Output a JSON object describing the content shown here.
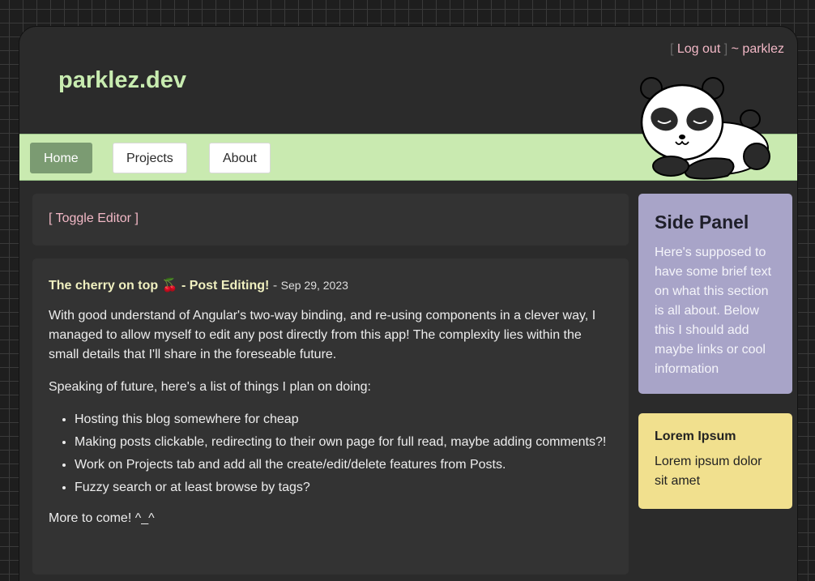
{
  "header": {
    "site_title": "parklez.dev",
    "bracket_open": "[",
    "logout_label": "Log out",
    "bracket_close": "]",
    "username": "~ parklez"
  },
  "nav": {
    "items": [
      {
        "label": "Home",
        "active": true
      },
      {
        "label": "Projects",
        "active": false
      },
      {
        "label": "About",
        "active": false
      }
    ]
  },
  "editor": {
    "toggle_label": "[ Toggle Editor ]"
  },
  "post": {
    "title": "The cherry on top 🍒 - Post Editing!",
    "separator": "-",
    "date": "Sep 29, 2023",
    "paragraph1": "With good understand of Angular's two-way binding, and re-using components in a clever way, I managed to allow myself to edit any post directly from this app! The complexity lies within the small details that I'll share in the foreseable future.",
    "paragraph2": "Speaking of future, here's a list of things I plan on doing:",
    "list": [
      "Hosting this blog somewhere for cheap",
      "Making posts clickable, redirecting to their own page for full read, maybe adding comments?!",
      "Work on Projects tab and add all the create/edit/delete features from Posts.",
      "Fuzzy search or at least browse by tags?"
    ],
    "closing": "More to come! ^_^"
  },
  "side_panel": {
    "title": "Side Panel",
    "text": "Here's supposed to have some brief text on what this section is all about. Below this I should add maybe links or cool information"
  },
  "lorem_box": {
    "title": "Lorem Ipsum",
    "text": "Lorem ipsum dolor sit amet"
  },
  "colors": {
    "accent_green": "#c8ecb0",
    "nav_bar": "#c9eab0",
    "nav_active": "#7b9b72",
    "link_pink": "#f2b8c6",
    "side_panel": "#a8a4c8",
    "lorem_box": "#f1e08e"
  },
  "icons": {
    "mascot": "sleeping-panda-icon"
  }
}
